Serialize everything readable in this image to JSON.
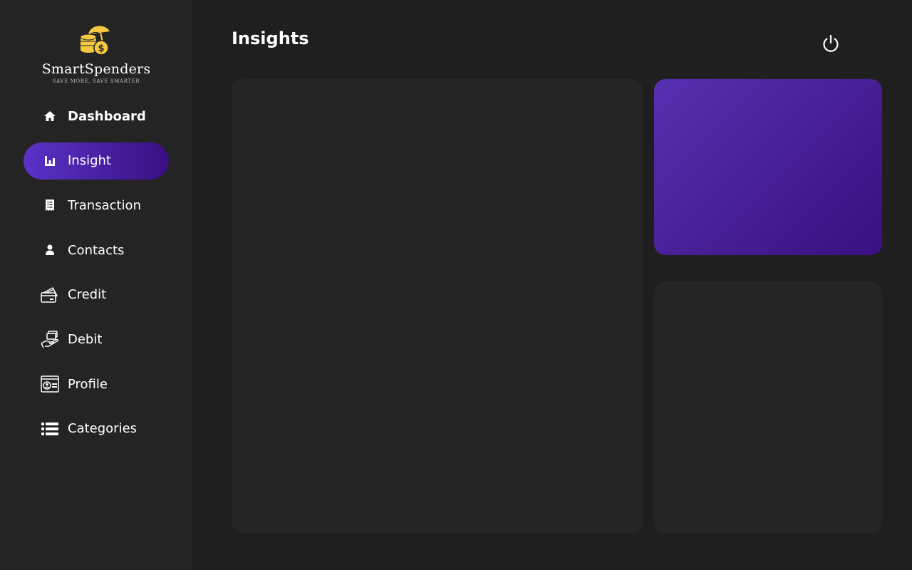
{
  "brand": {
    "name": "SmartSpenders",
    "tagline": "SAVE MORE, SAVE SMARTER",
    "logo_icon": "coins-umbrella-icon",
    "logo_color": "#f5c842"
  },
  "header": {
    "title": "Insights",
    "power_icon": "power-icon"
  },
  "sidebar": {
    "items": [
      {
        "label": "Dashboard",
        "icon": "home-icon",
        "active": false
      },
      {
        "label": "Insight",
        "icon": "bar-chart-icon",
        "active": true
      },
      {
        "label": "Transaction",
        "icon": "receipt-icon",
        "active": false
      },
      {
        "label": "Contacts",
        "icon": "person-icon",
        "active": false
      },
      {
        "label": "Credit",
        "icon": "credit-card-icon",
        "active": false
      },
      {
        "label": "Debit",
        "icon": "hand-card-icon",
        "active": false
      },
      {
        "label": "Profile",
        "icon": "id-card-icon",
        "active": false
      },
      {
        "label": "Categories",
        "icon": "list-icon",
        "active": false
      }
    ]
  },
  "colors": {
    "background": "#1f1f1f",
    "sidebar": "#242424",
    "panel": "#252525",
    "accent_start": "#5a32c8",
    "accent_end": "#3b0f82",
    "text": "#ffffff"
  }
}
